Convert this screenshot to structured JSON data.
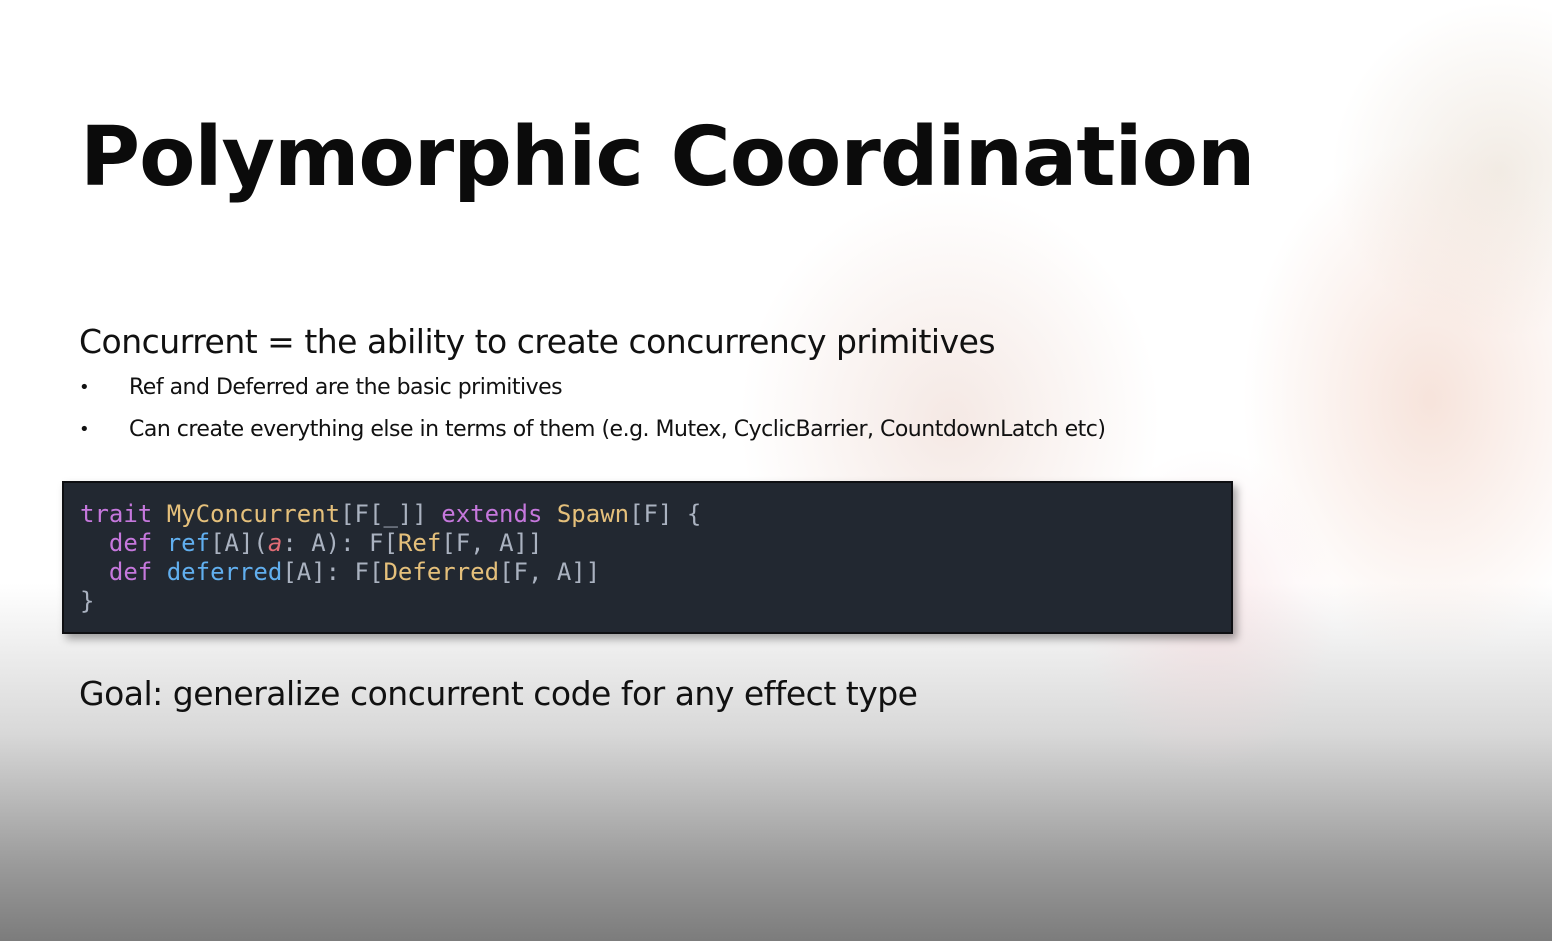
{
  "slide": {
    "title": "Polymorphic Coordination",
    "subtitle": "Concurrent = the ability to create concurrency primitives",
    "bullets": [
      {
        "marker": "•",
        "text": "Ref and Deferred are the basic primitives"
      },
      {
        "marker": "•",
        "text": "Can create everything else in terms of them (e.g. Mutex, CyclicBarrier, CountdownLatch etc)"
      }
    ],
    "code": {
      "line1": [
        {
          "t": "trait",
          "c": "kw"
        },
        {
          "t": " ",
          "c": "pu"
        },
        {
          "t": "MyConcurrent",
          "c": "ty"
        },
        {
          "t": "[F[_]] ",
          "c": "pu"
        },
        {
          "t": "extends",
          "c": "kw"
        },
        {
          "t": " ",
          "c": "pu"
        },
        {
          "t": "Spawn",
          "c": "ty"
        },
        {
          "t": "[F] {",
          "c": "pu"
        }
      ],
      "line2": [
        {
          "t": "  ",
          "c": "pu"
        },
        {
          "t": "def",
          "c": "kw"
        },
        {
          "t": " ",
          "c": "pu"
        },
        {
          "t": "ref",
          "c": "fn"
        },
        {
          "t": "[A](",
          "c": "pu"
        },
        {
          "t": "a",
          "c": "pa"
        },
        {
          "t": ": A): F[",
          "c": "pu"
        },
        {
          "t": "Ref",
          "c": "ty"
        },
        {
          "t": "[F, A]]",
          "c": "pu"
        }
      ],
      "line3": [
        {
          "t": "  ",
          "c": "pu"
        },
        {
          "t": "def",
          "c": "kw"
        },
        {
          "t": " ",
          "c": "pu"
        },
        {
          "t": "deferred",
          "c": "fn"
        },
        {
          "t": "[A]: F[",
          "c": "pu"
        },
        {
          "t": "Deferred",
          "c": "ty"
        },
        {
          "t": "[F, A]]",
          "c": "pu"
        }
      ],
      "line4": [
        {
          "t": "}",
          "c": "pu"
        }
      ]
    },
    "goal": "Goal: generalize concurrent code for any effect type"
  },
  "colors": {
    "code_background": "#222831",
    "keyword": "#c678dd",
    "type": "#e5c07b",
    "function": "#61afef",
    "parameter": "#e06c75",
    "punctuation": "#aab2c0"
  }
}
